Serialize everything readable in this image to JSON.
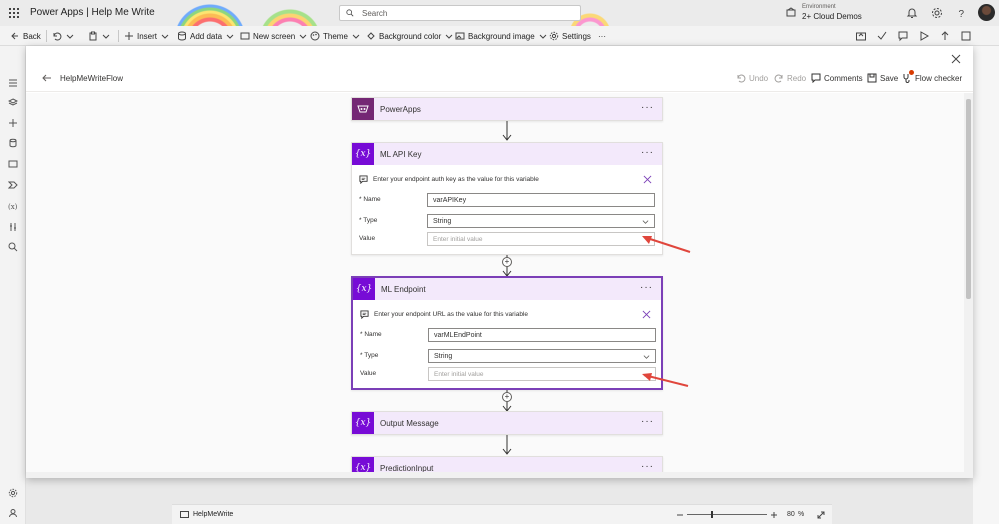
{
  "app": {
    "title": "Power Apps  |  Help Me Write",
    "search_placeholder": "Search",
    "environment_label": "Environment",
    "environment_value": "2+ Cloud Demos"
  },
  "commands": {
    "back": "Back",
    "insert": "Insert",
    "add_data": "Add data",
    "new_screen": "New screen",
    "theme": "Theme",
    "background_color": "Background color",
    "background_image": "Background image",
    "settings": "Settings",
    "more": "···"
  },
  "flow": {
    "name": "HelpMeWriteFlow",
    "actions": {
      "undo": "Undo",
      "redo": "Redo",
      "comments": "Comments",
      "save": "Save",
      "flow_checker": "Flow checker"
    },
    "steps": [
      {
        "title": "PowerApps",
        "more": "···"
      },
      {
        "title": "ML API Key",
        "more": "···",
        "hint": "Enter your endpoint auth key as the value for this variable",
        "name_label": "* Name",
        "name_value": "varAPIKey",
        "type_label": "* Type",
        "type_value": "String",
        "value_label": "Value",
        "value_placeholder": "Enter initial value"
      },
      {
        "title": "ML Endpoint",
        "more": "···",
        "hint": "Enter your endpoint URL as the value for this variable",
        "name_label": "* Name",
        "name_value": "varMLEndPoint",
        "type_label": "* Type",
        "type_value": "String",
        "value_label": "Value",
        "value_placeholder": "Enter initial value"
      },
      {
        "title": "Output Message",
        "more": "···"
      },
      {
        "title": "PredictionInput",
        "more": "···"
      }
    ]
  },
  "status": {
    "screen_name": "HelpMeWrite",
    "zoom_value": "80",
    "zoom_unit": "%"
  },
  "colors": {
    "variable_tile": "#770bd6",
    "powerapps_tile": "#742774",
    "header_tint": "#f3e9fb",
    "selected_border": "#7b3fb7",
    "annotation_arrow": "#e0463c"
  }
}
